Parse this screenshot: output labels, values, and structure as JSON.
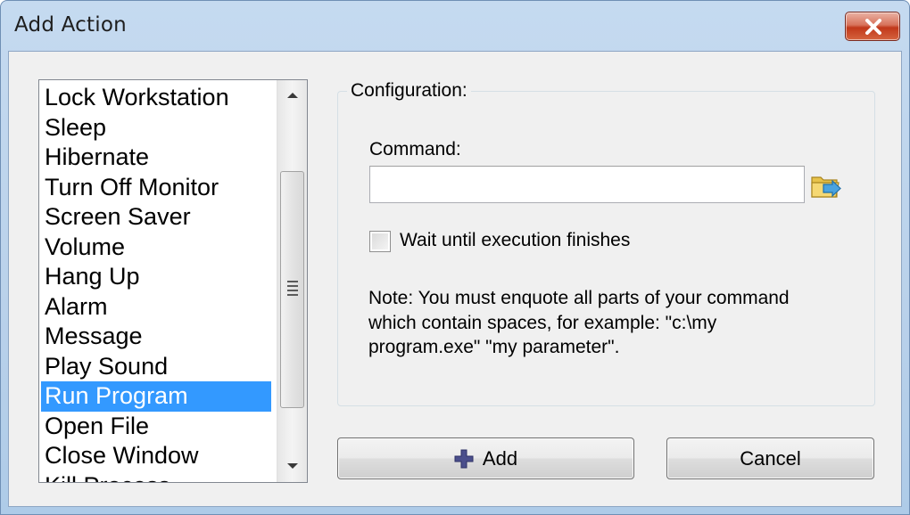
{
  "window": {
    "title": "Add Action"
  },
  "action_list": {
    "items": [
      "Lock Workstation",
      "Sleep",
      "Hibernate",
      "Turn Off Monitor",
      "Screen Saver",
      "Volume",
      "Hang Up",
      "Alarm",
      "Message",
      "Play Sound",
      "Run Program",
      "Open File",
      "Close Window",
      "Kill Process"
    ],
    "selected": "Run Program"
  },
  "configuration": {
    "group_label": "Configuration:",
    "command_label": "Command:",
    "command_value": "",
    "wait_label": "Wait until execution finishes",
    "wait_checked": false,
    "note": "Note: You must enquote all parts of your command which contain spaces, for example: \"c:\\my program.exe\" \"my parameter\"."
  },
  "buttons": {
    "add_label": "Add",
    "cancel_label": "Cancel"
  },
  "colors": {
    "selection": "#3399ff",
    "close_button": "#c7482b"
  }
}
